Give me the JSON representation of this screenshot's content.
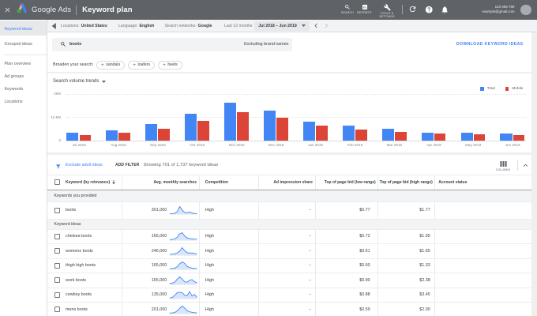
{
  "topbar": {
    "brand": "Google Ads",
    "page_title": "Keyword plan",
    "actions": [
      {
        "label": "SEARCH",
        "icon": "search-icon"
      },
      {
        "label": "REPORTS",
        "icon": "reports-icon"
      },
      {
        "label": "TOOLS &\nSETTINGS",
        "icon": "wrench-icon"
      }
    ],
    "account": {
      "id": "123-456-789",
      "email": "example@gmail.com"
    }
  },
  "sidebar": {
    "items": [
      {
        "label": "Keyword ideas",
        "selected": true
      },
      {
        "label": "Grouped ideas",
        "divider_after": true
      },
      {
        "label": "Plan overview"
      },
      {
        "label": "Ad groups"
      },
      {
        "label": "Keywords"
      },
      {
        "label": "Locations"
      }
    ]
  },
  "toolbar": {
    "filters": [
      {
        "label": "Locations:",
        "value": "United States",
        "x": 17
      },
      {
        "label": "Language:",
        "value": "English",
        "x": 90
      },
      {
        "label": "Search networks:",
        "value": "Google",
        "x": 148.6
      }
    ],
    "date_label": "Last 12 months",
    "date_value": "Jul 2018 – Jun 2019"
  },
  "search": {
    "query": "boots",
    "exclusion": "Excluding brand names",
    "download_label": "DOWNLOAD KEYWORD IDEAS",
    "broaden_label": "Broaden your search:",
    "chips": [
      "sandals",
      "loafers",
      "heels"
    ]
  },
  "chart_data": {
    "type": "bar",
    "title": "Search volume trends",
    "unit": "millions",
    "categories": [
      "Jul 2018",
      "Aug 2018",
      "Sep 2018",
      "Oct 2018",
      "Nov 2018",
      "Dec 2018",
      "Jan 2019",
      "Feb 2019",
      "Mar 2019",
      "Apr 2019",
      "May 2019",
      "Jun 2019"
    ],
    "series": [
      {
        "name": "Total",
        "color": "#4285f4",
        "values": [
          4.3,
          5.4,
          8.7,
          14.1,
          20.2,
          15.9,
          10.2,
          8.1,
          6.5,
          4.4,
          4.0,
          3.7
        ]
      },
      {
        "name": "Mobile",
        "color": "#db4437",
        "values": [
          2.9,
          4.1,
          6.3,
          10.6,
          15.2,
          12.2,
          7.9,
          6.0,
          4.8,
          3.6,
          3.5,
          3.1
        ]
      }
    ],
    "ylim": [
      0,
      25
    ],
    "yticks": [
      {
        "label": "0",
        "value": 0
      },
      {
        "label": "12.5M",
        "value": 12.5
      },
      {
        "label": "25M",
        "value": 25
      }
    ],
    "legend_position": "top-right",
    "grid": "dashed horizontal"
  },
  "filter_bar": {
    "exclude_label": "Exclude adult ideas",
    "add_filter_label": "ADD FILTER",
    "showing_text": "Showing 701 of 1,737 keyword ideas",
    "columns_label": "COLUMNS"
  },
  "table": {
    "columns": [
      "Keyword (by relevance)",
      "Avg. monthly searches",
      "Competition",
      "Ad impression share",
      "Top of page bid (low range)",
      "Top of page bid (high range)",
      "Account status"
    ],
    "sections": [
      {
        "header": "Keywords you provided",
        "rows": [
          {
            "keyword": "boots",
            "avg_monthly_searches": "301,000",
            "sparkline": [
              0.05,
              0.06,
              0.1,
              0.35,
              1.0,
              0.55,
              0.22,
              0.18,
              0.28,
              0.14,
              0.07,
              0.05
            ],
            "competition": "High",
            "ad_impression_share": "–",
            "top_of_page_bid_low": "$0.77",
            "top_of_page_bid_high": "$1.77",
            "account_status": ""
          }
        ]
      },
      {
        "header": "Keyword ideas",
        "rows": [
          {
            "keyword": "chelsea boots",
            "avg_monthly_searches": "165,000",
            "sparkline": [
              0.08,
              0.1,
              0.16,
              0.4,
              0.85,
              1.0,
              0.55,
              0.3,
              0.22,
              0.18,
              0.14,
              0.12
            ],
            "competition": "High",
            "ad_impression_share": "–",
            "top_of_page_bid_low": "$0.72",
            "top_of_page_bid_high": "$1.95",
            "account_status": ""
          },
          {
            "keyword": "womens boots",
            "avg_monthly_searches": "246,000",
            "sparkline": [
              0.12,
              0.14,
              0.18,
              0.3,
              0.55,
              1.0,
              0.6,
              0.35,
              0.28,
              0.3,
              0.22,
              0.18
            ],
            "competition": "High",
            "ad_impression_share": "–",
            "top_of_page_bid_low": "$0.61",
            "top_of_page_bid_high": "$1.65",
            "account_status": ""
          },
          {
            "keyword": "thigh high boots",
            "avg_monthly_searches": "165,000",
            "sparkline": [
              0.1,
              0.12,
              0.18,
              0.35,
              0.75,
              1.0,
              0.8,
              0.4,
              0.25,
              0.18,
              0.14,
              0.12
            ],
            "competition": "High",
            "ad_impression_share": "–",
            "top_of_page_bid_low": "$0.60",
            "top_of_page_bid_high": "$1.33",
            "account_status": ""
          },
          {
            "keyword": "work boots",
            "avg_monthly_searches": "165,000",
            "sparkline": [
              0.15,
              0.18,
              0.3,
              0.7,
              1.0,
              0.7,
              0.35,
              0.3,
              0.55,
              0.65,
              0.35,
              0.22
            ],
            "competition": "High",
            "ad_impression_share": "–",
            "top_of_page_bid_low": "$0.90",
            "top_of_page_bid_high": "$2.38",
            "account_status": ""
          },
          {
            "keyword": "cowboy boots",
            "avg_monthly_searches": "135,000",
            "sparkline": [
              0.1,
              0.15,
              0.45,
              0.8,
              0.85,
              0.8,
              0.45,
              0.4,
              0.95,
              0.35,
              0.55,
              0.15
            ],
            "competition": "High",
            "ad_impression_share": "–",
            "top_of_page_bid_low": "$0.88",
            "top_of_page_bid_high": "$3.45",
            "account_status": ""
          },
          {
            "keyword": "mens boots",
            "avg_monthly_searches": "201,000",
            "sparkline": [
              0.08,
              0.1,
              0.15,
              0.35,
              0.7,
              1.0,
              0.75,
              0.4,
              0.25,
              0.18,
              0.12,
              0.1
            ],
            "competition": "High",
            "ad_impression_share": "–",
            "top_of_page_bid_low": "$0.59",
            "top_of_page_bid_high": "$2.00",
            "account_status": ""
          }
        ]
      }
    ]
  }
}
